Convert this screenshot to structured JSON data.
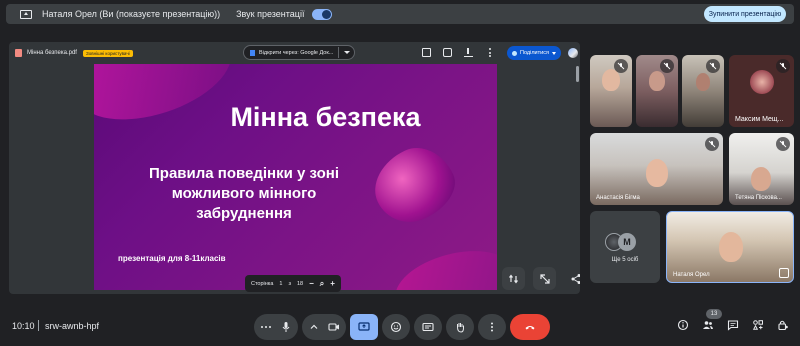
{
  "banner": {
    "title": "Наталя Орел (Ви (показуєте презентацію))",
    "sound_label": "Звук презентації",
    "stop_button": "Зупинити презентацію"
  },
  "pdf_viewer": {
    "file_name": "Мінна безпека.pdf",
    "tag": "Зовнішні користувачі",
    "open_with": "Відкрити через: Google Док...",
    "share_button": "Поділитися",
    "page_label": "Сторінка",
    "page_current": "1",
    "page_of": "з",
    "page_total": "18"
  },
  "slide": {
    "title": "Мінна безпека",
    "subtitle": "Правила поведінки у зоні можливого мінного забруднення",
    "footer": "презентація для 8-11класів"
  },
  "participants": [
    {
      "name": "",
      "muted": true
    },
    {
      "name": "",
      "muted": true
    },
    {
      "name": "",
      "muted": true
    },
    {
      "name": "Максим Мещ...",
      "muted": true
    },
    {
      "name": "Анастасія Бігма",
      "muted": true
    },
    {
      "name": "Тетяна Піскова...",
      "muted": true
    },
    {
      "name": "Ще 5 осіб",
      "avatar_letter": "M"
    },
    {
      "name": "Наталя Орел",
      "self": true
    }
  ],
  "meeting": {
    "time": "10:10",
    "code": "srw-awnb-hpf",
    "people_count": "13"
  },
  "colors": {
    "accent": "#8ab4f8",
    "end_call": "#ea4335",
    "stop_button_bg": "#c2e7ff",
    "share_button_bg": "#0b57d0"
  }
}
